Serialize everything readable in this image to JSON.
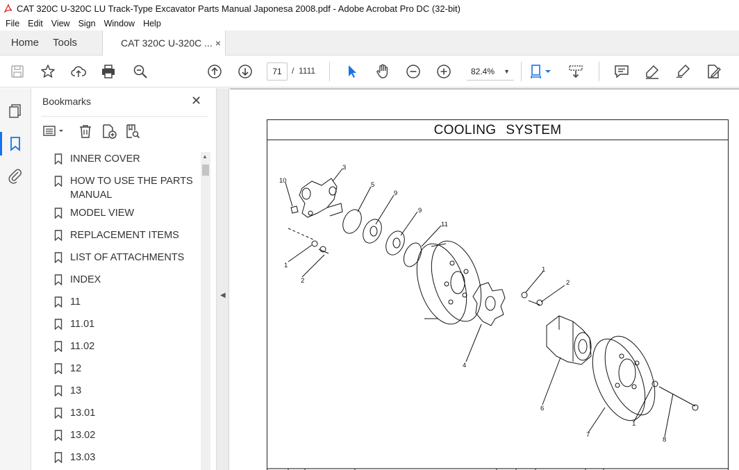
{
  "window": {
    "title": "CAT 320C U-320C LU Track-Type Excavator Parts Manual Japonesa 2008.pdf - Adobe Acrobat Pro DC (32-bit)"
  },
  "menu": [
    "File",
    "Edit",
    "View",
    "Sign",
    "Window",
    "Help"
  ],
  "tabs": {
    "home": "Home",
    "tools": "Tools",
    "document": "CAT 320C U-320C ...",
    "close": "×"
  },
  "toolbar": {
    "current_page": "71",
    "separator": "/",
    "total_pages": "1111",
    "zoom": "82.4%"
  },
  "bookmarks": {
    "title": "Bookmarks",
    "close": "✕",
    "items": [
      "INNER COVER",
      "HOW TO USE THE PARTS MANUAL",
      "MODEL VIEW",
      "REPLACEMENT ITEMS",
      "LIST OF ATTACHMENTS",
      "INDEX",
      "11",
      "11.01",
      "11.02",
      "12",
      "13",
      "13.01",
      "13.02",
      "13.03"
    ]
  },
  "document": {
    "section_word1": "COOLING",
    "section_word2": "SYSTEM",
    "callouts": {
      "c10": "10",
      "c3": "3",
      "c5": "5",
      "c9a": "9",
      "c9b": "9",
      "c11": "11",
      "c1a": "1",
      "c2a": "2",
      "c1b": "1",
      "c2b": "2",
      "c4": "4",
      "c6": "6",
      "c7": "7",
      "c1c": "1",
      "c8": "8"
    }
  },
  "colors": {
    "accent": "#1473e6",
    "pdf_red": "#e02020"
  }
}
